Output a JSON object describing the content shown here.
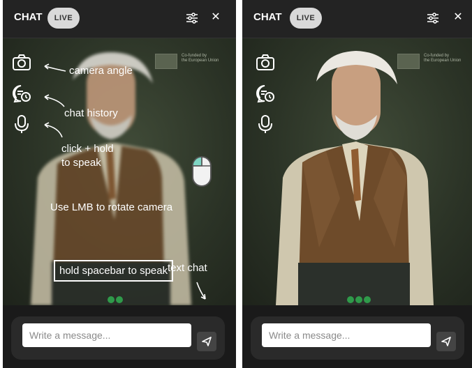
{
  "panels": [
    {
      "header": {
        "title": "CHAT",
        "live_label": "LIVE"
      },
      "sponsor": {
        "line1": "Co-funded by",
        "line2": "the European Union"
      },
      "annotations": {
        "camera": "camera angle",
        "history": "chat history",
        "speak_line1": "click + hold",
        "speak_line2": "to speak",
        "rotate": "Use LMB to rotate camera",
        "spacebar": "hold spacebar to speak",
        "text_chat": "text chat"
      },
      "input": {
        "placeholder": "Write a message..."
      }
    },
    {
      "header": {
        "title": "CHAT",
        "live_label": "LIVE"
      },
      "sponsor": {
        "line1": "Co-funded by",
        "line2": "the European Union"
      },
      "input": {
        "placeholder": "Write a message..."
      }
    }
  ],
  "icons": {
    "camera": "camera-icon",
    "history": "chat-history-icon",
    "mic": "microphone-icon",
    "settings": "sliders-icon",
    "close": "close-icon",
    "send": "send-icon",
    "mouse": "mouse-icon"
  },
  "colors": {
    "status_dot": "#2f9a4a",
    "panel_bg": "#1f1f1f",
    "pill_bg": "#d9d9d9"
  }
}
